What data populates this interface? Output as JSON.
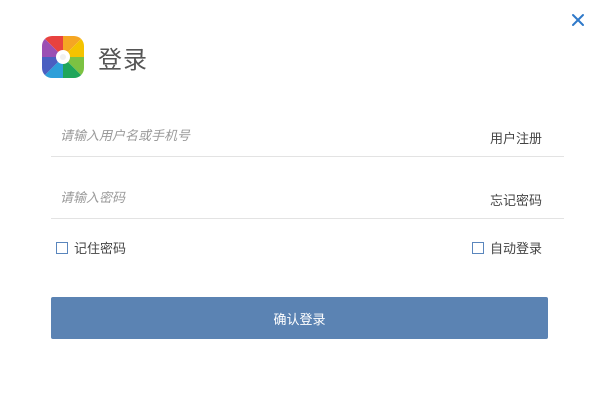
{
  "window": {
    "close_icon": "close-icon"
  },
  "header": {
    "logo_icon": "pinwheel-logo",
    "title": "登录"
  },
  "form": {
    "username": {
      "placeholder": "请输入用户名或手机号",
      "value": "",
      "side_link": "用户注册"
    },
    "password": {
      "placeholder": "请输入密码",
      "value": "",
      "side_link": "忘记密码"
    },
    "remember": {
      "label": "记住密码",
      "checked": false
    },
    "auto_login": {
      "label": "自动登录",
      "checked": false
    },
    "submit_label": "确认登录"
  },
  "colors": {
    "accent": "#5b83b3",
    "close": "#2f79c9",
    "checkbox_border": "#5a86bd",
    "title": "#555555",
    "divider": "#e3e3e3"
  }
}
